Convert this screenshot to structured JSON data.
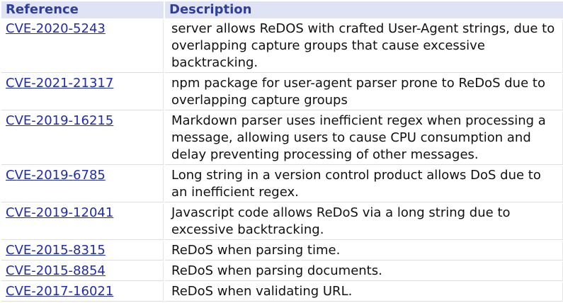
{
  "table": {
    "headers": {
      "reference": "Reference",
      "description": "Description"
    },
    "rows": [
      {
        "reference": "CVE-2020-5243",
        "description": "server allows ReDOS with crafted User-Agent strings, due to overlapping capture groups that cause excessive backtracking."
      },
      {
        "reference": "CVE-2021-21317",
        "description": "npm package for user-agent parser prone to ReDoS due to overlapping capture groups"
      },
      {
        "reference": "CVE-2019-16215",
        "description": "Markdown parser uses inefficient regex when processing a message, allowing users to cause CPU consumption and delay preventing processing of other messages."
      },
      {
        "reference": "CVE-2019-6785",
        "description": "Long string in a version control product allows DoS due to an inefficient regex."
      },
      {
        "reference": "CVE-2019-12041",
        "description": "Javascript code allows ReDoS via a long string due to excessive backtracking."
      },
      {
        "reference": "CVE-2015-8315",
        "description": "ReDoS when parsing time."
      },
      {
        "reference": "CVE-2015-8854",
        "description": "ReDoS when parsing documents."
      },
      {
        "reference": "CVE-2017-16021",
        "description": "ReDoS when validating URL."
      }
    ]
  },
  "colors": {
    "header_bg": "#dfe3f4",
    "header_text": "#2d3f9b",
    "link": "#1f2bb0"
  }
}
